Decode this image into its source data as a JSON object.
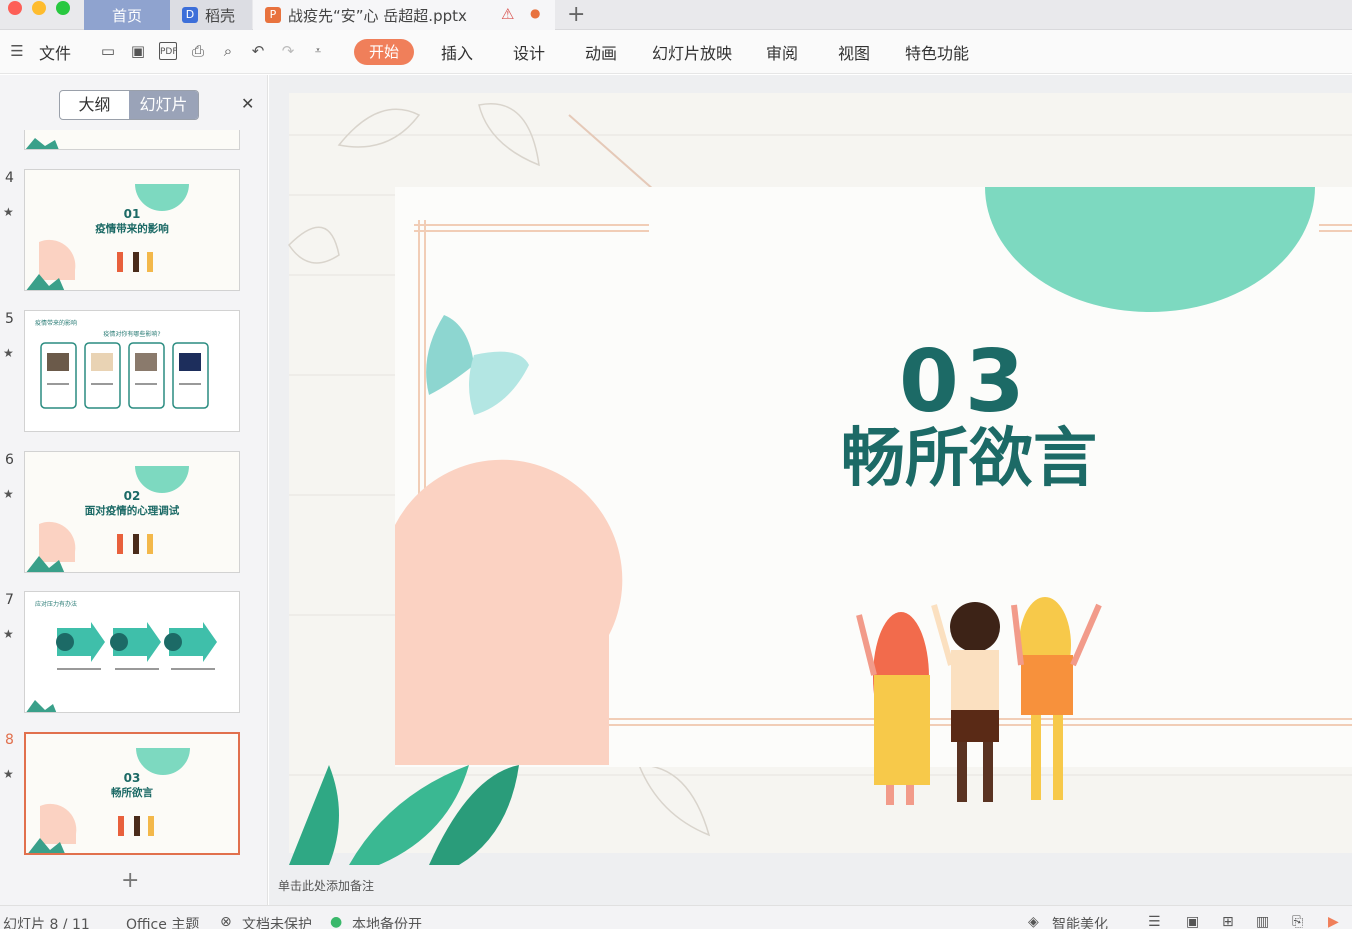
{
  "window": {
    "tabs": [
      {
        "label": "首页"
      },
      {
        "label": "稻壳"
      },
      {
        "label": "战疫先“安”心 岳超超.pptx"
      }
    ],
    "colors": {
      "home_tab": "#8fa3cf",
      "accent": "#f07f5a",
      "teal": "#1c6a66",
      "mint": "#7dd9c0",
      "peach": "#fbd2c2"
    }
  },
  "toolbar": {
    "file_label": "文件",
    "menu": [
      "开始",
      "插入",
      "设计",
      "动画",
      "幻灯片放映",
      "审阅",
      "视图",
      "特色功能"
    ],
    "icons": [
      "hamburger-icon",
      "open-folder-icon",
      "save-icon",
      "pdf-icon",
      "print-icon",
      "preview-icon",
      "undo-icon",
      "redo-icon",
      "more-icon"
    ]
  },
  "sidebar": {
    "view_tabs": [
      "大纲",
      "幻灯片"
    ],
    "active_view": "幻灯片",
    "slides": [
      {
        "number": "4",
        "num_title": "01",
        "title": "疫情带来的影响"
      },
      {
        "number": "5",
        "header": "疫情带来的影响",
        "subtitle": "疫情对你有哪些影响?"
      },
      {
        "number": "6",
        "num_title": "02",
        "title": "面对疫情的心理调试"
      },
      {
        "number": "7",
        "header": "应对压力有办法"
      },
      {
        "number": "8",
        "num_title": "03",
        "title": "畅所欲言",
        "selected": true
      }
    ]
  },
  "slide": {
    "number": "03",
    "title": "畅所欲言"
  },
  "notes_placeholder": "单击此处添加备注",
  "status": {
    "slide_info": "幻灯片 8 / 11",
    "theme": "Office 主题",
    "protect": "文档未保护",
    "backup": "本地备份开",
    "beautify": "智能美化"
  }
}
